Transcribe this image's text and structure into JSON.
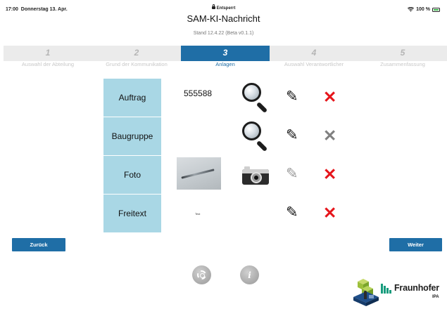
{
  "status_bar": {
    "time": "17:00",
    "date": "Donnerstag 13. Apr.",
    "lock_status": "Entsperrt",
    "battery": "100 %",
    "icons": [
      "wifi-icon",
      "battery-icon",
      "lock-icon"
    ]
  },
  "header": {
    "title": "SAM-KI-Nachricht",
    "subtitle": "Stand 12.4.22 (Beta v0.1.1)"
  },
  "steps": [
    {
      "number": "1",
      "label": "Auswahl der Abteilung",
      "active": false
    },
    {
      "number": "2",
      "label": "Grund der Kommunikation",
      "active": false
    },
    {
      "number": "3",
      "label": "Anlagen",
      "active": true
    },
    {
      "number": "4",
      "label": "Auswahl Verantwortlicher",
      "active": false
    },
    {
      "number": "5",
      "label": "Zusammenfassung",
      "active": false
    }
  ],
  "rows": [
    {
      "label": "Auftrag",
      "value": "555588",
      "action_icon": "magnifier-icon",
      "delete_enabled": true
    },
    {
      "label": "Baugruppe",
      "value": "",
      "action_icon": "magnifier-icon",
      "delete_enabled": false
    },
    {
      "label": "Foto",
      "value": "",
      "action_icon": "camera-icon",
      "delete_enabled": true
    },
    {
      "label": "Freitext",
      "value": "Test",
      "action_icon": "",
      "delete_enabled": true
    }
  ],
  "navigation": {
    "back_label": "Zurück",
    "next_label": "Weiter"
  },
  "footer": {
    "brand": "Fraunhofer",
    "brand_sub": "IPA"
  },
  "colors": {
    "accent": "#1f6ea6",
    "row_button": "#a9d7e5",
    "delete": "#e6151b",
    "delete_disabled": "#808080",
    "brand_green": "#179c7d"
  }
}
